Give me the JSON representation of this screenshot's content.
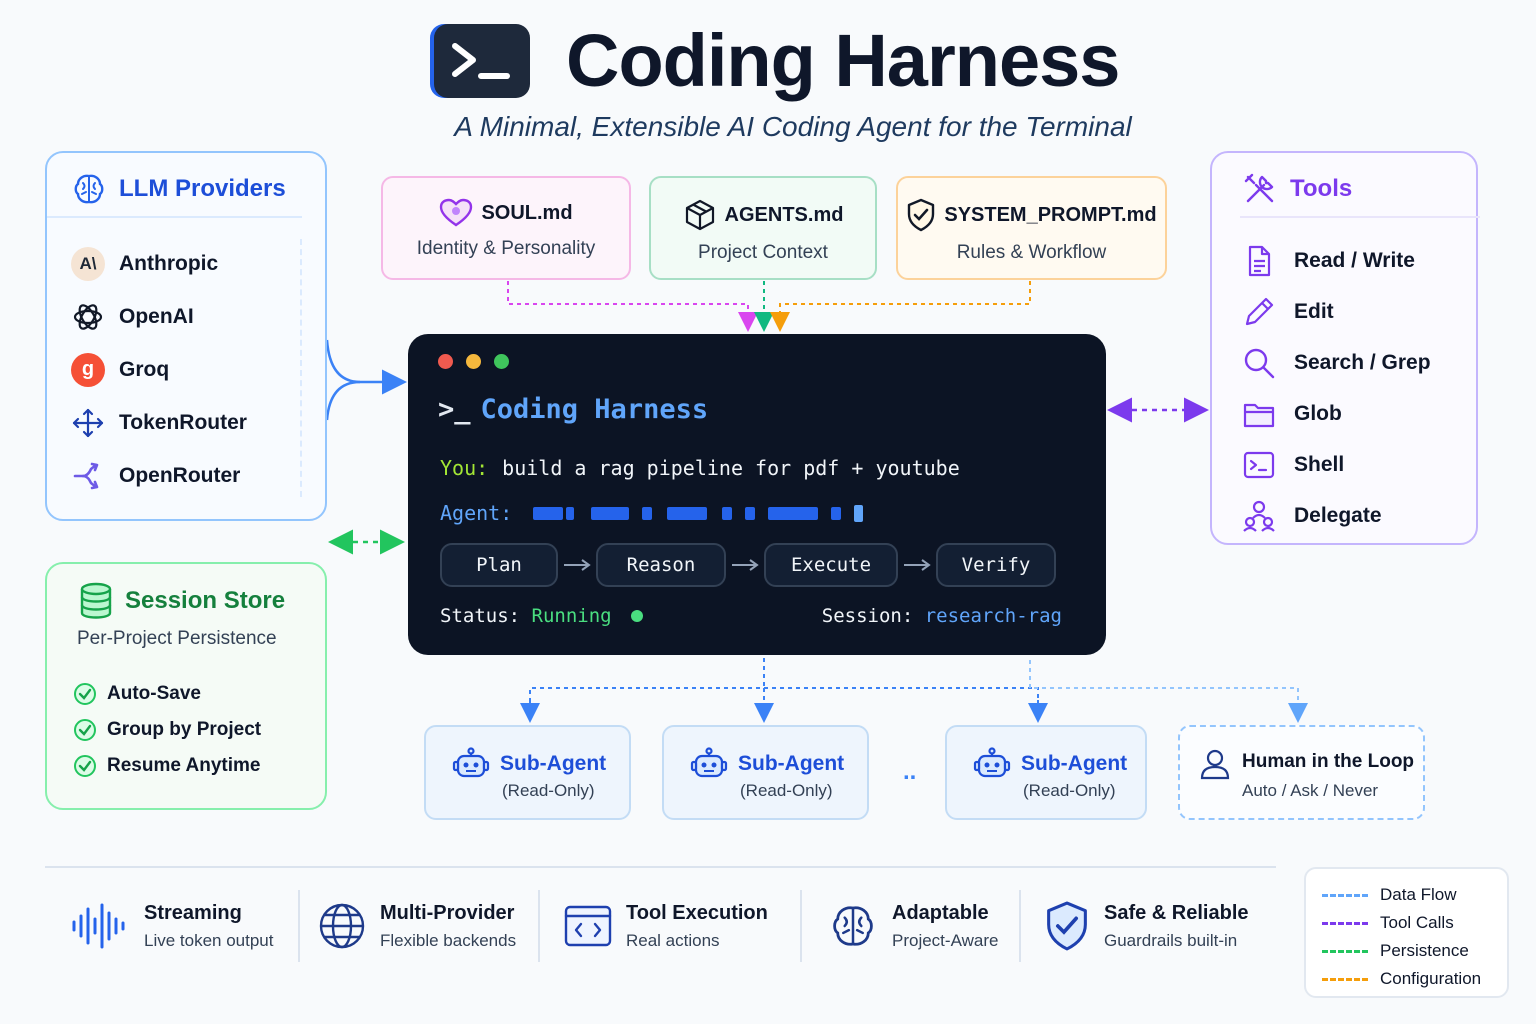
{
  "header": {
    "title": "Coding Harness",
    "subtitle": "A Minimal, Extensible AI Coding Agent for the Terminal",
    "logo_icon": "terminal-prompt-icon"
  },
  "llm_providers": {
    "title": "LLM Providers",
    "icon": "brain-icon",
    "items": [
      {
        "label": "Anthropic",
        "icon": "anthropic-icon"
      },
      {
        "label": "OpenAI",
        "icon": "openai-icon"
      },
      {
        "label": "Groq",
        "icon": "groq-icon"
      },
      {
        "label": "TokenRouter",
        "icon": "router-arrows-icon"
      },
      {
        "label": "OpenRouter",
        "icon": "openrouter-icon"
      }
    ]
  },
  "session_store": {
    "title": "Session Store",
    "subtitle": "Per-Project Persistence",
    "icon": "database-icon",
    "items": [
      "Auto-Save",
      "Group by Project",
      "Resume Anytime"
    ]
  },
  "tools": {
    "title": "Tools",
    "icon": "tools-icon",
    "items": [
      {
        "label": "Read / Write",
        "icon": "file-icon"
      },
      {
        "label": "Edit",
        "icon": "pencil-icon"
      },
      {
        "label": "Search / Grep",
        "icon": "search-icon"
      },
      {
        "label": "Glob",
        "icon": "folder-icon"
      },
      {
        "label": "Shell",
        "icon": "terminal-icon"
      },
      {
        "label": "Delegate",
        "icon": "users-icon"
      }
    ]
  },
  "config_files": [
    {
      "title": "SOUL.md",
      "subtitle": "Identity & Personality",
      "icon": "heart-icon"
    },
    {
      "title": "AGENTS.md",
      "subtitle": "Project Context",
      "icon": "cube-icon"
    },
    {
      "title": "SYSTEM_PROMPT.md",
      "subtitle": "Rules & Workflow",
      "icon": "shield-check-icon"
    }
  ],
  "terminal": {
    "prompt": ">_",
    "title": "Coding Harness",
    "you_label": "You:",
    "you_text": "build a rag pipeline for pdf + youtube",
    "agent_label": "Agent:",
    "steps": [
      "Plan",
      "Reason",
      "Execute",
      "Verify"
    ],
    "status_label": "Status:",
    "status_value": "Running",
    "session_label": "Session:",
    "session_value": "research-rag",
    "colors": {
      "you": "#a3e635",
      "agent": "#60a5fa",
      "running": "#4ade80"
    }
  },
  "sub_agents": [
    {
      "title": "Sub-Agent",
      "subtitle": "(Read-Only)",
      "icon": "robot-icon"
    },
    {
      "title": "Sub-Agent",
      "subtitle": "(Read-Only)",
      "icon": "robot-icon"
    },
    {
      "title": "Sub-Agent",
      "subtitle": "(Read-Only)",
      "icon": "robot-icon"
    }
  ],
  "ellipsis": "..",
  "human_in_loop": {
    "title": "Human in the Loop",
    "subtitle": "Auto / Ask / Never",
    "icon": "user-icon"
  },
  "features": [
    {
      "title": "Streaming",
      "subtitle": "Live token output",
      "icon": "waveform-icon"
    },
    {
      "title": "Multi-Provider",
      "subtitle": "Flexible backends",
      "icon": "globe-icon"
    },
    {
      "title": "Tool Execution",
      "subtitle": "Real actions",
      "icon": "code-window-icon"
    },
    {
      "title": "Adaptable",
      "subtitle": "Project-Aware",
      "icon": "brain-icon"
    },
    {
      "title": "Safe & Reliable",
      "subtitle": "Guardrails built-in",
      "icon": "shield-check-icon"
    }
  ],
  "legend": [
    {
      "label": "Data Flow",
      "color": "#60a5fa"
    },
    {
      "label": "Tool Calls",
      "color": "#7c3aed"
    },
    {
      "label": "Persistence",
      "color": "#22c55e"
    },
    {
      "label": "Configuration",
      "color": "#f59e0b"
    }
  ]
}
